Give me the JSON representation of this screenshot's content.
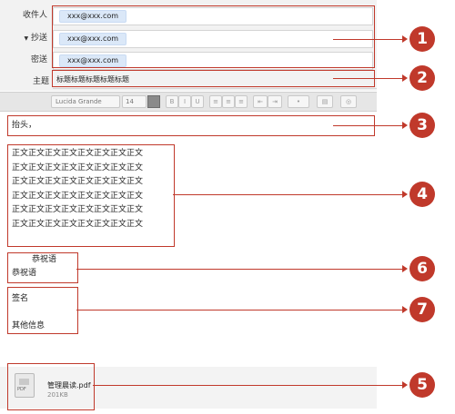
{
  "header": {
    "to_label": "收件人",
    "cc_label": "抄送",
    "cc_toggle": "▼",
    "bcc_label": "密送",
    "subject_label": "主题",
    "to_chip": "xxx@xxx.com",
    "cc_chip": "xxx@xxx.com",
    "bcc_chip": "xxx@xxx.com",
    "subject_value": "标题标题标题标题标题"
  },
  "toolbar": {
    "font": "Lucida Grande",
    "size": "14",
    "buttons": [
      "B",
      "I",
      "U",
      "≡",
      "≡",
      "≡",
      "⇤",
      "⇥",
      "•",
      "▤",
      "◎"
    ]
  },
  "body": {
    "greeting": "抬头，",
    "paragraph_lines": [
      "正文正文正文正文正文正文正文正文",
      "正文正文正文正文正文正文正文正文",
      "正文正文正文正文正文正文正文正文",
      "正文正文正文正文正文正文正文正文",
      "正文正文正文正文正文正文正文正文",
      "正文正文正文正文正文正文正文正文"
    ],
    "closing_1": "恭祝语",
    "closing_2": "恭祝语",
    "signature": "签名",
    "other_info": "其他信息"
  },
  "attachment": {
    "filename": "管理晨读.pdf",
    "size": "201KB",
    "icon_label": "PDF"
  },
  "annotations": {
    "n1": "1",
    "n2": "2",
    "n3": "3",
    "n4": "4",
    "n5": "5",
    "n6": "6",
    "n7": "7"
  },
  "colors": {
    "annotation": "#c0392b",
    "chip": "#dbe8f8",
    "header_bg": "#f2f2f2"
  }
}
